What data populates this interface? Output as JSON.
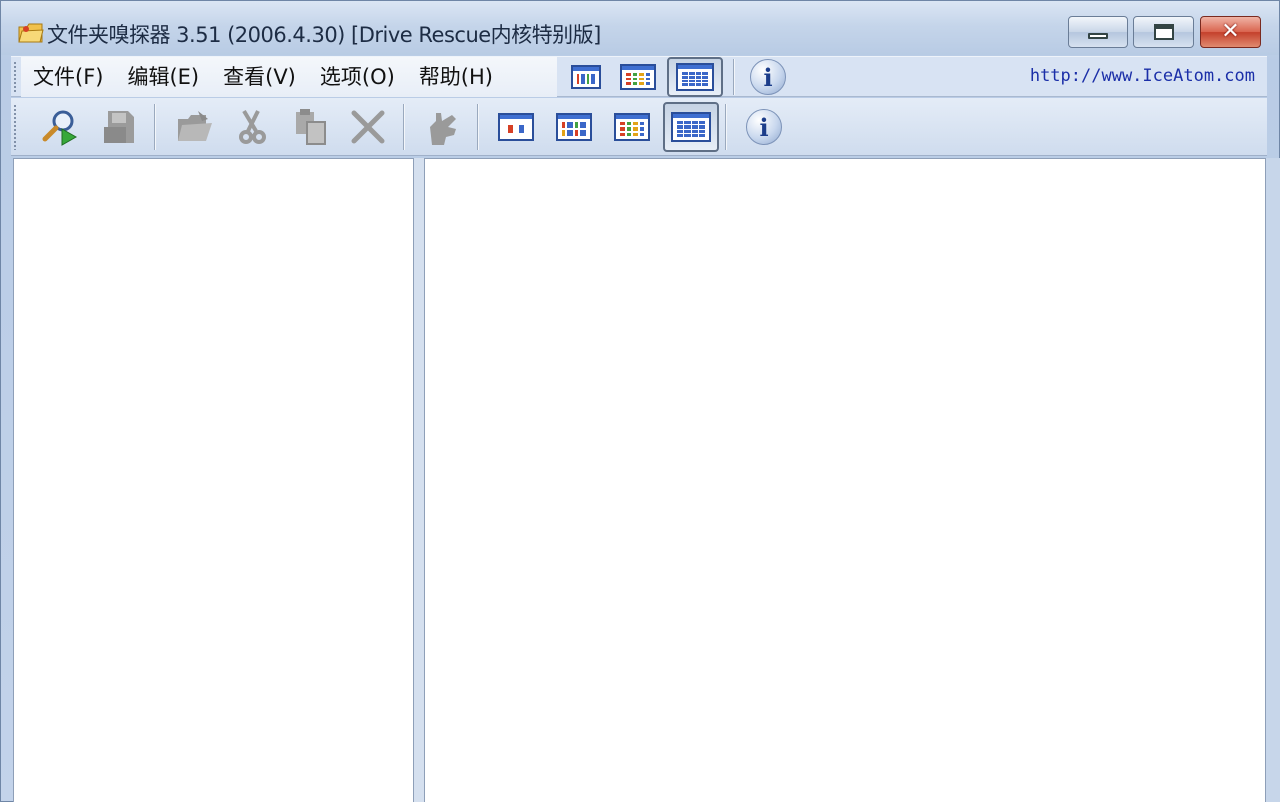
{
  "window": {
    "title": "文件夹嗅探器 3.51 (2006.4.30) [Drive Rescue内核特别版]",
    "caption_buttons": {
      "minimize": "minimize-icon",
      "maximize": "maximize-icon",
      "close_glyph": "✕"
    }
  },
  "menubar": {
    "items": [
      {
        "label": "文件(F)"
      },
      {
        "label": "编辑(E)"
      },
      {
        "label": "查看(V)"
      },
      {
        "label": "选项(O)"
      },
      {
        "label": "帮助(H)"
      }
    ],
    "url": "http://www.IceAtom.com"
  },
  "toolbar": {
    "buttons": [
      {
        "icon": "search-icon",
        "enabled": true
      },
      {
        "icon": "save-icon",
        "enabled": false
      },
      {
        "icon": "open-icon",
        "enabled": false
      },
      {
        "icon": "cut-icon",
        "enabled": false
      },
      {
        "icon": "copy-icon",
        "enabled": false
      },
      {
        "icon": "delete-icon",
        "enabled": false
      },
      {
        "icon": "hand-icon",
        "enabled": false
      },
      {
        "icon": "view-large-icons-icon",
        "enabled": true
      },
      {
        "icon": "view-small-icons-icon",
        "enabled": true
      },
      {
        "icon": "view-list-icon",
        "enabled": true
      },
      {
        "icon": "view-details-icon",
        "enabled": true,
        "pressed": true
      },
      {
        "icon": "info-icon",
        "enabled": true
      }
    ],
    "info_glyph": "i"
  },
  "colors": {
    "accent": "#2a4e9a",
    "close_button": "#d9644e",
    "link": "#1b2fa8"
  }
}
